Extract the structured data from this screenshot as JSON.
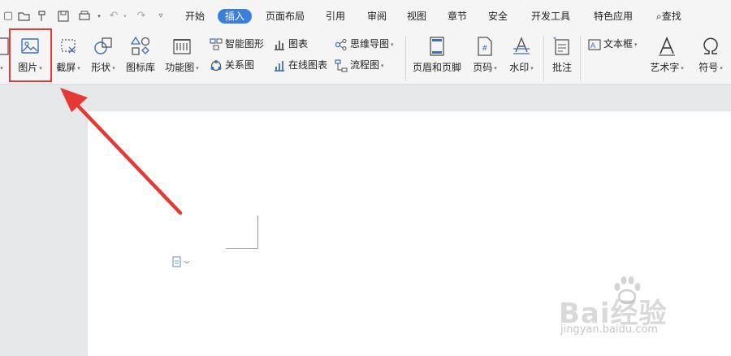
{
  "menu": {
    "tabs": [
      "开始",
      "插入",
      "页面布局",
      "引用",
      "审阅",
      "视图",
      "章节",
      "安全",
      "开发工具",
      "特色应用"
    ],
    "active_tab": "插入",
    "search_label": "查找"
  },
  "ribbon": {
    "picture": "图片",
    "screenshot": "截屏",
    "shapes": "形状",
    "icon_library": "图标库",
    "function_chart": "功能图",
    "smart_graphic": "智能图形",
    "chart": "图表",
    "relation_chart": "关系图",
    "online_chart": "在线图表",
    "mind_map": "思维导图",
    "flowchart": "流程图",
    "header_footer": "页眉和页脚",
    "page_number": "页码",
    "watermark": "水印",
    "comment": "批注",
    "textbox": "文本框",
    "wordart": "艺术字",
    "symbol": "符号"
  },
  "annotation": {
    "highlight_color": "#e53935",
    "arrow_color": "#e53935"
  },
  "watermark": {
    "line1": "Bai经验",
    "line2": "jingyan.baidu.com"
  },
  "colors": {
    "accent": "#3b7fdd",
    "icon": "#3d6fb8"
  }
}
